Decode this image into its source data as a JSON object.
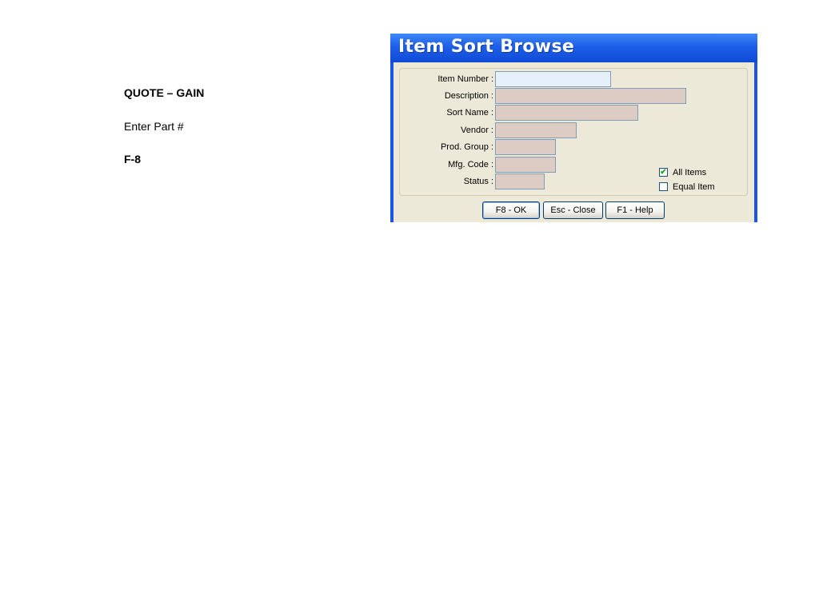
{
  "notes": {
    "title": "QUOTE – GAIN",
    "step": "Enter Part #",
    "key": "F-8"
  },
  "window": {
    "title": "Item Sort Browse"
  },
  "fields": {
    "item_number": {
      "label": "Item Number :",
      "value": ""
    },
    "description": {
      "label": "Description :",
      "value": ""
    },
    "sort_name": {
      "label": "Sort Name :",
      "value": ""
    },
    "vendor": {
      "label": "Vendor :",
      "value": ""
    },
    "prod_group": {
      "label": "Prod. Group :",
      "value": ""
    },
    "mfg_code": {
      "label": "Mfg. Code :",
      "value": ""
    },
    "status": {
      "label": "Status :",
      "value": ""
    }
  },
  "options": {
    "all_items": {
      "label": "All Items",
      "checked": true
    },
    "equal_item": {
      "label": "Equal Item",
      "checked": false
    }
  },
  "buttons": {
    "ok": "F8 - OK",
    "close": "Esc - Close",
    "help": "F1 - Help"
  },
  "colors": {
    "titlebar": "#1f5fe8",
    "dialog_bg": "#ece9d8",
    "field_bg": "#ddccc4",
    "active_field_bg": "#e6f0fb"
  }
}
